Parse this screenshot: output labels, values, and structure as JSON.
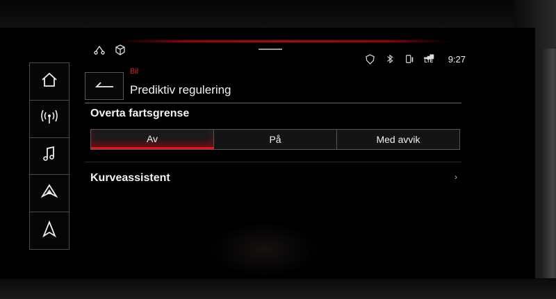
{
  "status_bar": {
    "left_icons": [
      "route-icon",
      "cube-icon"
    ],
    "right_icons": [
      "shield-phone-icon",
      "bluetooth-icon",
      "phone-battery-icon",
      "lte-icon"
    ],
    "lte_label": "LTE",
    "time": "9:27"
  },
  "sidebar": {
    "items": [
      {
        "name": "home",
        "icon": "home-icon"
      },
      {
        "name": "radio",
        "icon": "radio-antenna-icon"
      },
      {
        "name": "media",
        "icon": "music-note-icon"
      },
      {
        "name": "car",
        "icon": "car-icon"
      },
      {
        "name": "navigation",
        "icon": "navigation-arrow-icon"
      }
    ]
  },
  "header": {
    "breadcrumb": "Bil",
    "title": "Prediktiv regulering"
  },
  "setting": {
    "label": "Overta fartsgrense",
    "options": [
      "Av",
      "På",
      "Med avvik"
    ],
    "selected": "Av"
  },
  "list": {
    "items": [
      {
        "label": "Kurveassistent"
      }
    ]
  },
  "colors": {
    "accent": "#d91a26",
    "background": "#000000",
    "text": "#f2f2f2"
  }
}
